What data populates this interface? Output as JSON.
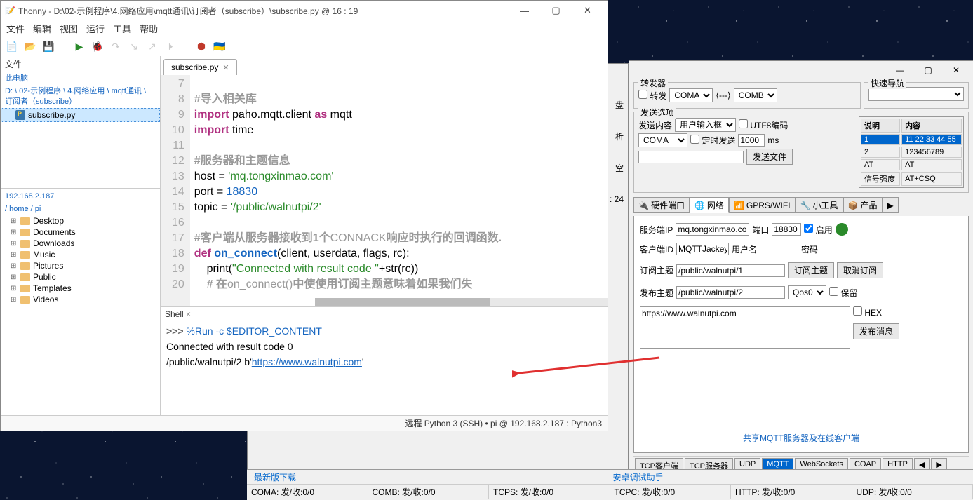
{
  "thonny": {
    "title": "Thonny  -  D:\\02-示例程序\\4.网络应用\\mqtt通讯\\订阅者（subscribe）\\subscribe.py  @  16 : 19",
    "menus": [
      "文件",
      "编辑",
      "视图",
      "运行",
      "工具",
      "帮助"
    ],
    "files_label": "文件",
    "local_root": "此电脑",
    "local_path": "D: \\ 02-示例程序 \\ 4.网络应用 \\ mqtt通讯 \\ 订阅者（subscribe）",
    "local_file": "subscribe.py",
    "remote_host": "192.168.2.187",
    "remote_path": "/ home / pi",
    "remote_tree": [
      "Desktop",
      "Documents",
      "Downloads",
      "Music",
      "Pictures",
      "Public",
      "Templates",
      "Videos"
    ],
    "editor_tab": "subscribe.py",
    "code_lines": [
      7,
      8,
      9,
      10,
      11,
      12,
      13,
      14,
      15,
      16,
      17,
      18,
      19,
      20
    ],
    "code": {
      "l7": "#导入相关库",
      "l8a": "import",
      "l8b": " paho.mqtt.client ",
      "l8c": "as",
      "l8d": " mqtt",
      "l9a": "import",
      "l9b": " time",
      "l11": "#服务器和主题信息",
      "l12a": "host = ",
      "l12b": "'mq.tongxinmao.com'",
      "l13a": "port = ",
      "l13b": "18830",
      "l14a": "topic = ",
      "l14b": "'/public/walnutpi/2'",
      "l16a": "#客户端从服务器接收到1个",
      "l16b": "CONNACK",
      "l16c": "响应时执行的回调函数.",
      "l17a": "def ",
      "l17b": "on_connect",
      "l17c": "(client, userdata, flags, rc):",
      "l18a": "    print(",
      "l18b": "\"Connected with result code \"",
      "l18c": "+str(rc))",
      "l19a": "    # 在",
      "l19b": "on_connect()",
      "l19c": "中使使用订阅主题意味着如果我们失"
    },
    "shell_label": "Shell",
    "shell": {
      "prompt": ">>> ",
      "cmd": "%Run -c $EDITOR_CONTENT",
      "out1": "Connected with result code 0",
      "out2a": "/public/walnutpi/2 b'",
      "out2b": "https://www.walnutpi.com",
      "out2c": "'"
    },
    "status": "远程 Python 3 (SSH)  •  pi @ 192.168.2.187 : Python3"
  },
  "partial": {
    "btns": [
      "盘",
      "析",
      "空"
    ],
    "colpos": ": 24"
  },
  "rtool": {
    "forwarder": {
      "legend": "转发器",
      "chk": "转发",
      "comA": "COMA",
      "comB": "COMB"
    },
    "nav": {
      "legend": "快速导航"
    },
    "sendopt": {
      "legend": "发送选项",
      "content_lbl": "发送内容",
      "content_opt": "用户输入框",
      "utf8": "UTF8编码",
      "com": "COMA",
      "timed": "定时发送",
      "interval": "1000",
      "ms": "ms",
      "sendfile": "发送文件",
      "table": {
        "h1": "说明",
        "h2": "内容",
        "rows": [
          [
            "1",
            "11 22 33 44 55"
          ],
          [
            "2",
            "123456789"
          ],
          [
            "AT",
            "AT"
          ],
          [
            "信号强度",
            "AT+CSQ"
          ]
        ]
      }
    },
    "tabs": [
      "硬件端口",
      "网络",
      "GPRS/WIFI",
      "小工具",
      "产品"
    ],
    "net": {
      "server_ip_lbl": "服务端IP",
      "server_ip": "mq.tongxinmao.com",
      "port_lbl": "端口",
      "port": "18830",
      "enable": "启用",
      "client_id_lbl": "客户端ID",
      "client_id": "MQTTJackey",
      "user_lbl": "用户名",
      "pwd_lbl": "密码",
      "sub_lbl": "订阅主题",
      "sub": "/public/walnutpi/1",
      "sub_btn": "订阅主题",
      "unsub_btn": "取消订阅",
      "pub_lbl": "发布主题",
      "pub": "/public/walnutpi/2",
      "qos": "Qos0",
      "retain": "保留",
      "msg": "https://www.walnutpi.com",
      "hex": "HEX",
      "pub_btn": "发布消息",
      "share": "共享MQTT服务器及在线客户端"
    },
    "bottom_tabs": [
      "TCP客户端",
      "TCP服务器",
      "UDP",
      "MQTT",
      "WebSockets",
      "COAP",
      "HTTP"
    ]
  },
  "status": {
    "lnk1": "最新版下载",
    "lnk2": "安卓调试助手",
    "cells": [
      "COMA: 发/收:0/0",
      "COMB: 发/收:0/0",
      "TCPS: 发/收:0/0",
      "TCPC: 发/收:0/0",
      "HTTP: 发/收:0/0",
      "UDP: 发/收:0/0"
    ]
  }
}
